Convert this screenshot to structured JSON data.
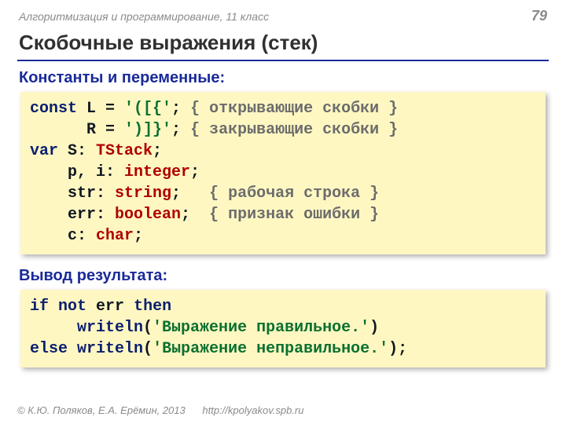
{
  "header": {
    "course": "Алгоритмизация и программирование, 11 класс",
    "pageNumber": "79"
  },
  "title": "Скобочные выражения (стек)",
  "sections": {
    "consts": "Константы и переменные:",
    "output": "Вывод результата:"
  },
  "code1": {
    "l1_kw": "const",
    "l1_a": " L = ",
    "l1_str": "'([{'",
    "l1_b": "; ",
    "l1_cmt": "{ открывающие скобки }",
    "l2_a": "      R = ",
    "l2_str": "')]}'",
    "l2_b": "; ",
    "l2_cmt": "{ закрывающие скобки }",
    "l3_kw": "var",
    "l3_a": " S: ",
    "l3_type": "TStack",
    "l3_b": ";",
    "l4_a": "    p, i: ",
    "l4_type": "integer",
    "l4_b": ";",
    "l5_a": "    str: ",
    "l5_type": "string",
    "l5_b": ";   ",
    "l5_cmt": "{ рабочая строка }",
    "l6_a": "    err: ",
    "l6_type": "boolean",
    "l6_b": ";  ",
    "l6_cmt": "{ признак ошибки }",
    "l7_a": "    c: ",
    "l7_type": "char",
    "l7_b": ";"
  },
  "code2": {
    "l1_if": "if",
    "l1_sp1": " ",
    "l1_not": "not",
    "l1_err": " err ",
    "l1_then": "then",
    "l2_pad": "     ",
    "l2_w": "writeln",
    "l2_op": "(",
    "l2_str": "'Выражение правильное.'",
    "l2_cl": ")",
    "l3_else": "else",
    "l3_sp": " ",
    "l3_w": "writeln",
    "l3_op": "(",
    "l3_str": "'Выражение неправильное.'",
    "l3_cl": ");"
  },
  "footer": {
    "copyright": "© К.Ю. Поляков, Е.А. Ерёмин, 2013",
    "url": "http://kpolyakov.spb.ru"
  }
}
